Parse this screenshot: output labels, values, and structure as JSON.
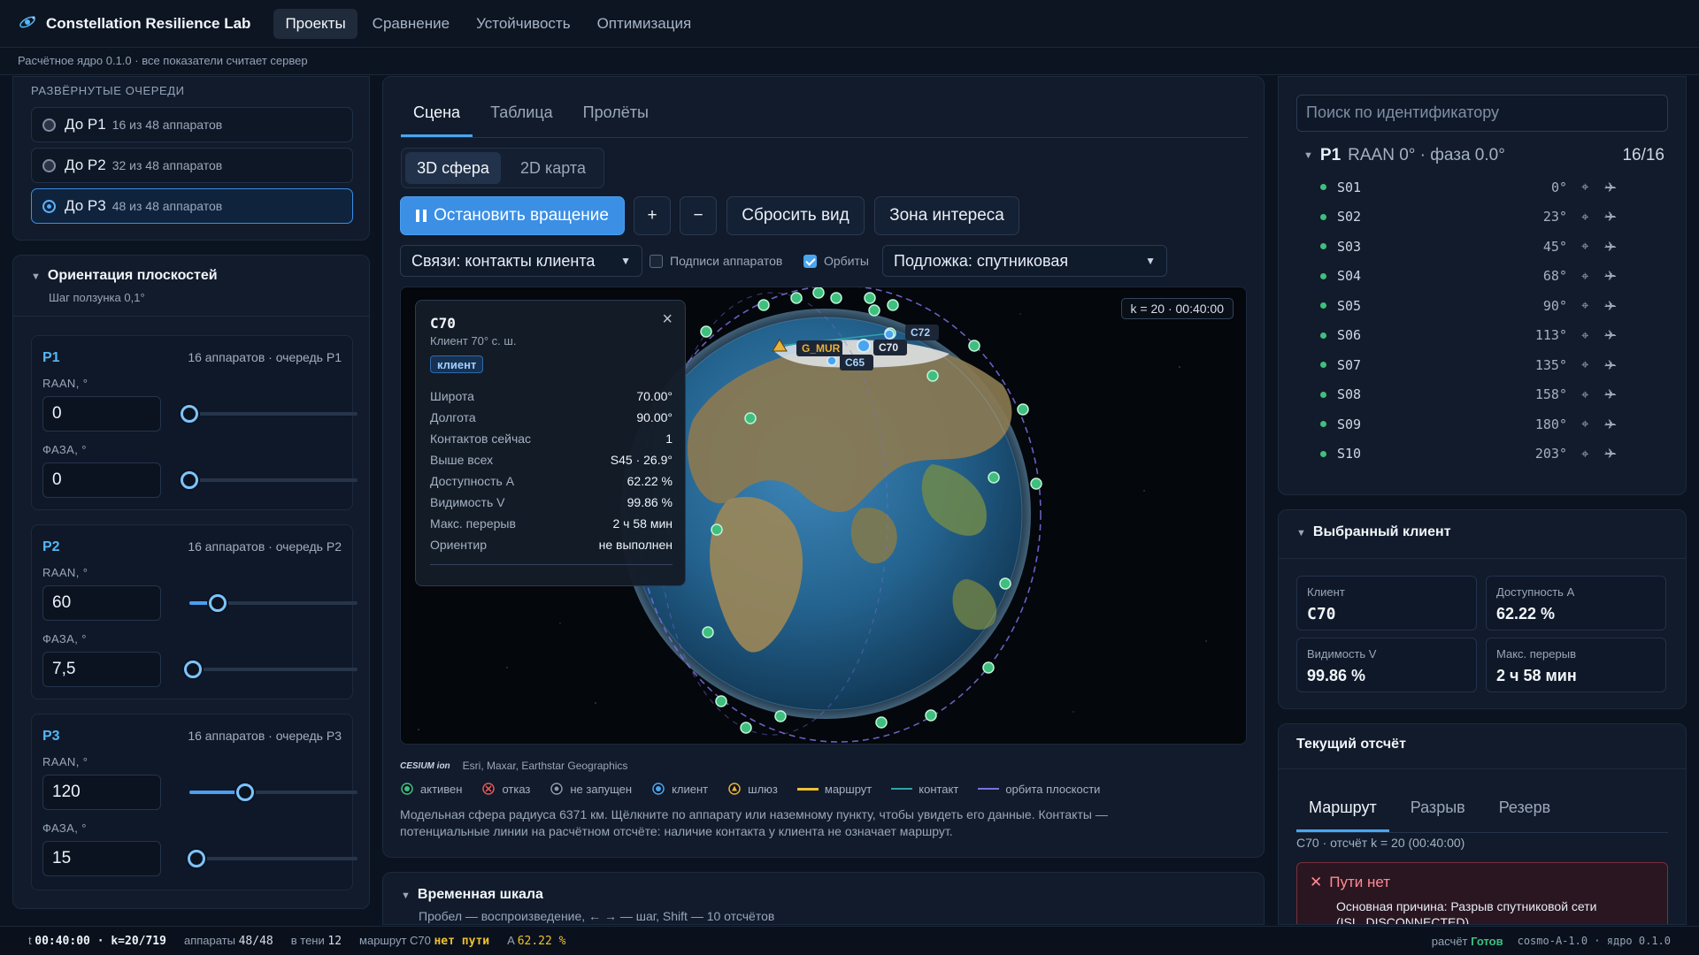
{
  "app": {
    "title": "Constellation Resilience Lab",
    "nav": [
      "Проекты",
      "Сравнение",
      "Устойчивость",
      "Оптимизация"
    ],
    "active_nav": 0
  },
  "subbar": "Расчётное ядро 0.1.0 · все показатели считает сервер",
  "queues": {
    "heading": "РАЗВЁРНУТЫЕ ОЧЕРЕДИ",
    "items": [
      {
        "label": "До P1",
        "sub": "16 из 48 аппаратов"
      },
      {
        "label": "До P2",
        "sub": "32 из 48 аппаратов"
      },
      {
        "label": "До P3",
        "sub": "48 из 48 аппаратов"
      }
    ],
    "selected": 2
  },
  "orientation": {
    "title": "Ориентация плоскостей",
    "step": "Шаг ползунка 0,1°",
    "raan_label": "RAAN, °",
    "phase_label": "ФАЗА, °",
    "planes": [
      {
        "name": "P1",
        "meta": "16 аппаратов · очередь P1",
        "raan": "0",
        "phase": "0",
        "raan_frac": 0.0,
        "phase_frac": 0.0
      },
      {
        "name": "P2",
        "meta": "16 аппаратов · очередь P2",
        "raan": "60",
        "phase": "7,5",
        "raan_frac": 0.167,
        "phase_frac": 0.021
      },
      {
        "name": "P3",
        "meta": "16 аппаратов · очередь P3",
        "raan": "120",
        "phase": "15",
        "raan_frac": 0.333,
        "phase_frac": 0.042
      }
    ]
  },
  "scene": {
    "tabs": [
      "Сцена",
      "Таблица",
      "Пролёты"
    ],
    "view_tabs": [
      "3D сфера",
      "2D карта"
    ],
    "buttons": {
      "stop": "Остановить вращение",
      "plus": "+",
      "minus": "−",
      "reset": "Сбросить вид",
      "roi": "Зона интереса"
    },
    "links_select": "Связи: контакты клиента",
    "chk_labels": "Подписи аппаратов",
    "chk_orbits": "Орбиты",
    "chk_labels_on": false,
    "chk_orbits_on": true,
    "basemap_select": "Подложка: спутниковая",
    "time_badge": "k = 20 · 00:40:00",
    "labels": {
      "g_mur": "G_MUR",
      "c65": "C65",
      "c70": "C70",
      "c72": "C72"
    },
    "popup": {
      "title": "C70",
      "subtitle": "Клиент 70° с. ш.",
      "tag": "клиент",
      "rows": [
        {
          "k": "Широта",
          "v": "70.00°"
        },
        {
          "k": "Долгота",
          "v": "90.00°"
        },
        {
          "k": "Контактов сейчас",
          "v": "1"
        },
        {
          "k": "Выше всех",
          "v": "S45 · 26.9°"
        },
        {
          "k": "Доступность A",
          "v": "62.22 %"
        },
        {
          "k": "Видимость V",
          "v": "99.86 %"
        },
        {
          "k": "Макс. перерыв",
          "v": "2 ч 58 мин"
        },
        {
          "k": "Ориентир",
          "v": "не выполнен"
        }
      ]
    },
    "credits": {
      "logo": "CESIUM ion",
      "text": "Esri, Maxar, Earthstar Geographics"
    },
    "legend": [
      "активен",
      "отказ",
      "не запущен",
      "клиент",
      "шлюз",
      "маршрут",
      "контакт",
      "орбита плоскости"
    ],
    "note": "Модельная сфера радиуса 6371 км. Щёлкните по аппарату или наземному пункту, чтобы увидеть его данные. Контакты — потенциальные линии на расчётном отсчёте: наличие контакта у клиента не означает маршрут."
  },
  "timeline": {
    "title": "Временная шкала",
    "hint": "Пробел — воспроизведение, ← → — шаг, Shift — 10 отсчётов"
  },
  "right": {
    "search_placeholder": "Поиск по идентификатору",
    "plane_name": "P1",
    "plane_desc": "RAAN 0° · фаза 0.0°",
    "plane_count": "16/16",
    "sats": [
      {
        "id": "S01",
        "ang": "0°"
      },
      {
        "id": "S02",
        "ang": "23°"
      },
      {
        "id": "S03",
        "ang": "45°"
      },
      {
        "id": "S04",
        "ang": "68°"
      },
      {
        "id": "S05",
        "ang": "90°"
      },
      {
        "id": "S06",
        "ang": "113°"
      },
      {
        "id": "S07",
        "ang": "135°"
      },
      {
        "id": "S08",
        "ang": "158°"
      },
      {
        "id": "S09",
        "ang": "180°"
      },
      {
        "id": "S10",
        "ang": "203°"
      }
    ],
    "client": {
      "title": "Выбранный клиент",
      "kpis": [
        {
          "k": "Клиент",
          "v": "C70"
        },
        {
          "k": "Доступность A",
          "v": "62.22 %"
        },
        {
          "k": "Видимость V",
          "v": "99.86 %"
        },
        {
          "k": "Макс. перерыв",
          "v": "2 ч 58 мин"
        }
      ]
    },
    "report": {
      "title": "Текущий отсчёт",
      "tabs": [
        "Маршрут",
        "Разрыв",
        "Резерв"
      ],
      "line": "C70 · отсчёт k = 20 (00:40:00)",
      "alert_title": "Пути нет",
      "alert_text": "Основная причина: Разрыв спутниковой сети (ISL_DISCONNECTED)"
    }
  },
  "status": {
    "t_label": "t",
    "t_value": "00:40:00 · k=20/719",
    "sats_label": "аппараты",
    "sats_value": "48/48",
    "shadow_label": "в тени",
    "shadow_value": "12",
    "route_label": "маршрут C70",
    "route_value": "нет пути",
    "a_label": "A",
    "a_value": "62.22 %",
    "calc_label": "расчёт",
    "calc_value": "Готов",
    "version": "cosmo-A-1.0 · ядро 0.1.0"
  },
  "colors": {
    "accent": "#4aa5ef",
    "active": "#3fbf7e",
    "fail": "#e05a5a",
    "warn": "#e8b13a",
    "route": "#f0c030",
    "contact": "#2fa3a8",
    "orbit": "#7d6fe0"
  }
}
